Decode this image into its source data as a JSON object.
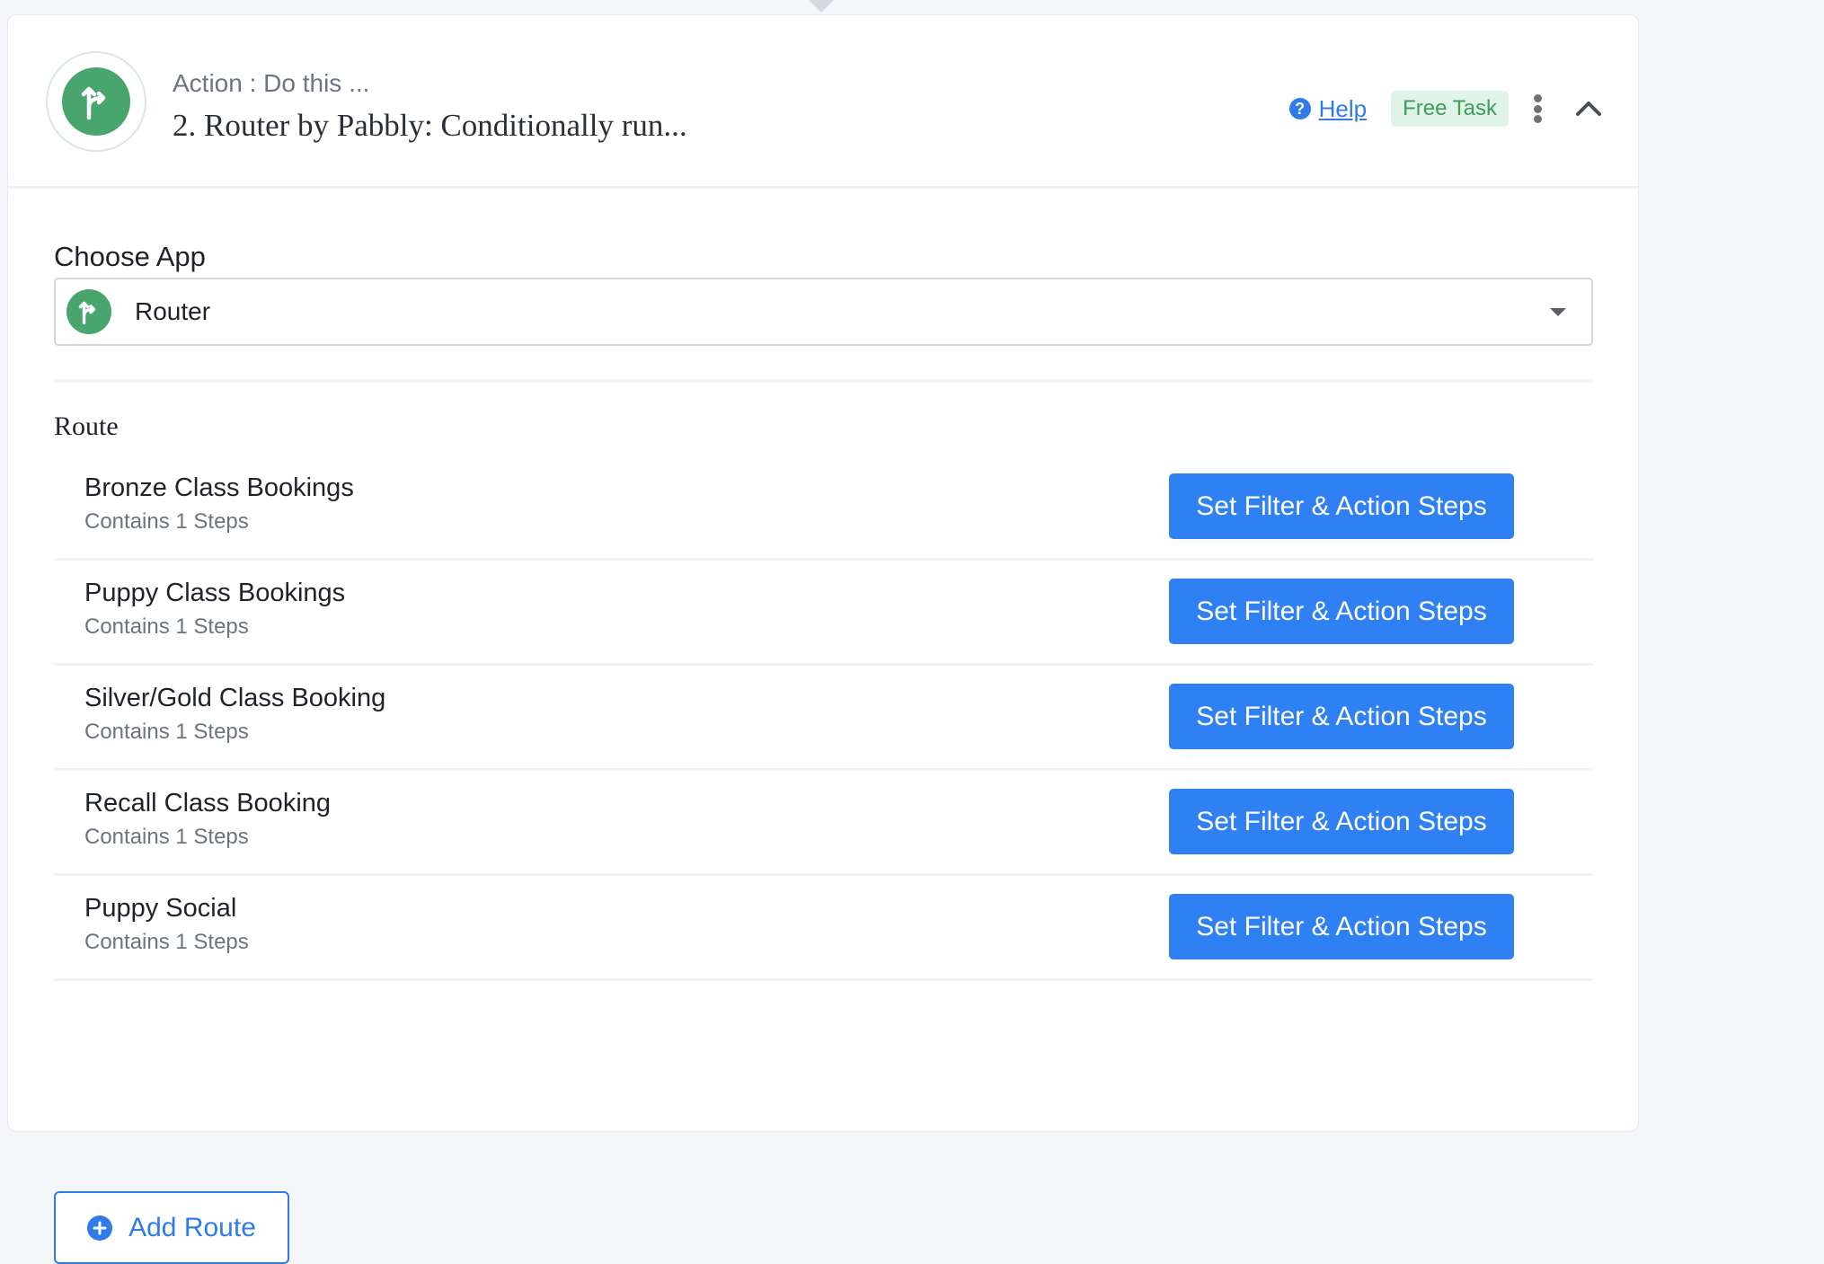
{
  "header": {
    "subtitle": "Action : Do this ...",
    "title": "2. Router by Pabbly: Conditionally run...",
    "help_label": "Help",
    "badge_label": "Free Task",
    "app_icon": "router-branch-icon"
  },
  "choose_app": {
    "label": "Choose App",
    "selected_value": "Router",
    "app_icon": "router-branch-icon"
  },
  "routes": {
    "label": "Route",
    "items": [
      {
        "name": "Bronze Class Bookings",
        "steps": "Contains 1 Steps",
        "button_label": "Set Filter & Action Steps"
      },
      {
        "name": "Puppy Class Bookings",
        "steps": "Contains 1 Steps",
        "button_label": "Set Filter & Action Steps"
      },
      {
        "name": "Silver/Gold Class Booking",
        "steps": "Contains 1 Steps",
        "button_label": "Set Filter & Action Steps"
      },
      {
        "name": "Recall Class Booking",
        "steps": "Contains 1 Steps",
        "button_label": "Set Filter & Action Steps"
      },
      {
        "name": "Puppy Social",
        "steps": "Contains 1 Steps",
        "button_label": "Set Filter & Action Steps"
      }
    ],
    "add_label": "Add Route"
  },
  "colors": {
    "brand_green": "#49a56e",
    "primary_blue": "#2f80f2",
    "link_blue": "#2f7be8",
    "badge_bg": "#dff4e6",
    "badge_text": "#3e9c5e"
  }
}
